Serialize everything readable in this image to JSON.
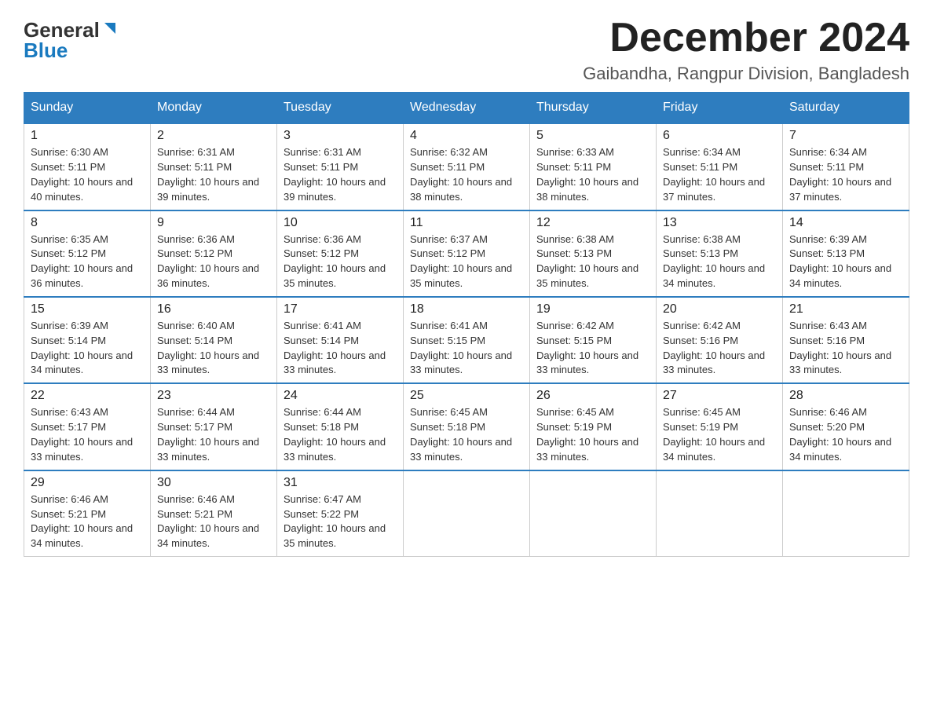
{
  "logo": {
    "general": "General",
    "blue": "Blue"
  },
  "title": "December 2024",
  "location": "Gaibandha, Rangpur Division, Bangladesh",
  "days_of_week": [
    "Sunday",
    "Monday",
    "Tuesday",
    "Wednesday",
    "Thursday",
    "Friday",
    "Saturday"
  ],
  "weeks": [
    [
      {
        "day": "1",
        "sunrise": "6:30 AM",
        "sunset": "5:11 PM",
        "daylight": "10 hours and 40 minutes."
      },
      {
        "day": "2",
        "sunrise": "6:31 AM",
        "sunset": "5:11 PM",
        "daylight": "10 hours and 39 minutes."
      },
      {
        "day": "3",
        "sunrise": "6:31 AM",
        "sunset": "5:11 PM",
        "daylight": "10 hours and 39 minutes."
      },
      {
        "day": "4",
        "sunrise": "6:32 AM",
        "sunset": "5:11 PM",
        "daylight": "10 hours and 38 minutes."
      },
      {
        "day": "5",
        "sunrise": "6:33 AM",
        "sunset": "5:11 PM",
        "daylight": "10 hours and 38 minutes."
      },
      {
        "day": "6",
        "sunrise": "6:34 AM",
        "sunset": "5:11 PM",
        "daylight": "10 hours and 37 minutes."
      },
      {
        "day": "7",
        "sunrise": "6:34 AM",
        "sunset": "5:11 PM",
        "daylight": "10 hours and 37 minutes."
      }
    ],
    [
      {
        "day": "8",
        "sunrise": "6:35 AM",
        "sunset": "5:12 PM",
        "daylight": "10 hours and 36 minutes."
      },
      {
        "day": "9",
        "sunrise": "6:36 AM",
        "sunset": "5:12 PM",
        "daylight": "10 hours and 36 minutes."
      },
      {
        "day": "10",
        "sunrise": "6:36 AM",
        "sunset": "5:12 PM",
        "daylight": "10 hours and 35 minutes."
      },
      {
        "day": "11",
        "sunrise": "6:37 AM",
        "sunset": "5:12 PM",
        "daylight": "10 hours and 35 minutes."
      },
      {
        "day": "12",
        "sunrise": "6:38 AM",
        "sunset": "5:13 PM",
        "daylight": "10 hours and 35 minutes."
      },
      {
        "day": "13",
        "sunrise": "6:38 AM",
        "sunset": "5:13 PM",
        "daylight": "10 hours and 34 minutes."
      },
      {
        "day": "14",
        "sunrise": "6:39 AM",
        "sunset": "5:13 PM",
        "daylight": "10 hours and 34 minutes."
      }
    ],
    [
      {
        "day": "15",
        "sunrise": "6:39 AM",
        "sunset": "5:14 PM",
        "daylight": "10 hours and 34 minutes."
      },
      {
        "day": "16",
        "sunrise": "6:40 AM",
        "sunset": "5:14 PM",
        "daylight": "10 hours and 33 minutes."
      },
      {
        "day": "17",
        "sunrise": "6:41 AM",
        "sunset": "5:14 PM",
        "daylight": "10 hours and 33 minutes."
      },
      {
        "day": "18",
        "sunrise": "6:41 AM",
        "sunset": "5:15 PM",
        "daylight": "10 hours and 33 minutes."
      },
      {
        "day": "19",
        "sunrise": "6:42 AM",
        "sunset": "5:15 PM",
        "daylight": "10 hours and 33 minutes."
      },
      {
        "day": "20",
        "sunrise": "6:42 AM",
        "sunset": "5:16 PM",
        "daylight": "10 hours and 33 minutes."
      },
      {
        "day": "21",
        "sunrise": "6:43 AM",
        "sunset": "5:16 PM",
        "daylight": "10 hours and 33 minutes."
      }
    ],
    [
      {
        "day": "22",
        "sunrise": "6:43 AM",
        "sunset": "5:17 PM",
        "daylight": "10 hours and 33 minutes."
      },
      {
        "day": "23",
        "sunrise": "6:44 AM",
        "sunset": "5:17 PM",
        "daylight": "10 hours and 33 minutes."
      },
      {
        "day": "24",
        "sunrise": "6:44 AM",
        "sunset": "5:18 PM",
        "daylight": "10 hours and 33 minutes."
      },
      {
        "day": "25",
        "sunrise": "6:45 AM",
        "sunset": "5:18 PM",
        "daylight": "10 hours and 33 minutes."
      },
      {
        "day": "26",
        "sunrise": "6:45 AM",
        "sunset": "5:19 PM",
        "daylight": "10 hours and 33 minutes."
      },
      {
        "day": "27",
        "sunrise": "6:45 AM",
        "sunset": "5:19 PM",
        "daylight": "10 hours and 34 minutes."
      },
      {
        "day": "28",
        "sunrise": "6:46 AM",
        "sunset": "5:20 PM",
        "daylight": "10 hours and 34 minutes."
      }
    ],
    [
      {
        "day": "29",
        "sunrise": "6:46 AM",
        "sunset": "5:21 PM",
        "daylight": "10 hours and 34 minutes."
      },
      {
        "day": "30",
        "sunrise": "6:46 AM",
        "sunset": "5:21 PM",
        "daylight": "10 hours and 34 minutes."
      },
      {
        "day": "31",
        "sunrise": "6:47 AM",
        "sunset": "5:22 PM",
        "daylight": "10 hours and 35 minutes."
      },
      null,
      null,
      null,
      null
    ]
  ]
}
